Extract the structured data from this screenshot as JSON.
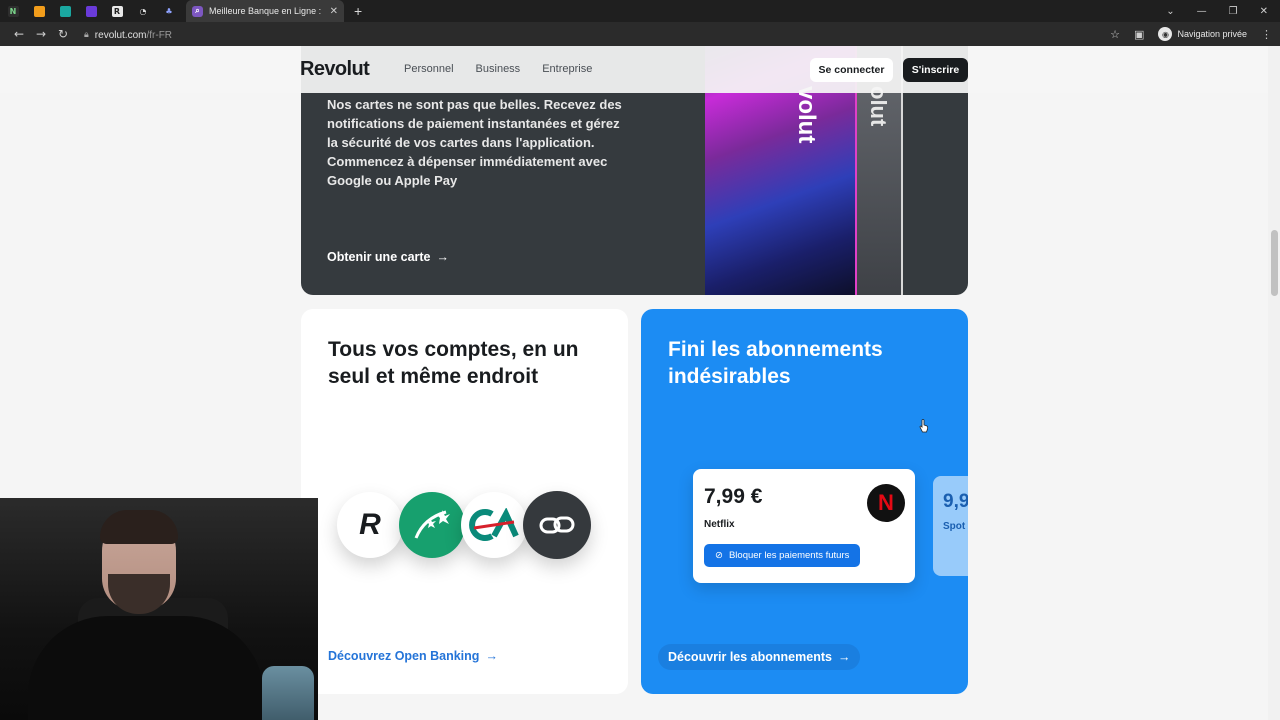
{
  "browser": {
    "active_tab_title": "Meilleure Banque en Ligne : Com",
    "url_host": "revolut.com",
    "url_path": "/fr-FR",
    "incognito_label": "Navigation privée"
  },
  "header": {
    "logo": "Revolut",
    "nav": [
      "Personnel",
      "Business",
      "Entreprise"
    ],
    "login": "Se connecter",
    "signup": "S'inscrire"
  },
  "card_promo": {
    "text": "Nos cartes ne sont pas que belles. Recevez des notifications de paiement instantanées et gérez la sécurité de vos cartes dans l'application. Commencez à dépenser immédiatement avec Google ou Apple Pay",
    "link": "Obtenir une carte",
    "card_word_1": "volut",
    "card_word_2": "olut"
  },
  "open_banking": {
    "title": "Tous vos comptes, en un seul et même endroit",
    "link": "Découvrez Open Banking",
    "bank_logo_letter": "R"
  },
  "subscriptions": {
    "title": "Fini les abonnements indésirables",
    "price": "7,99 €",
    "merchant": "Netflix",
    "merchant_logo": "N",
    "block_button": "Bloquer les paiements futurs",
    "price_2": "9,9",
    "merchant_2": "Spot",
    "link": "Découvrir les abonnements"
  },
  "colors": {
    "accent_blue": "#1c8cf3",
    "link_blue": "#2474d8",
    "dark_card": "#353a3e",
    "bnp_green": "#17a06e"
  }
}
